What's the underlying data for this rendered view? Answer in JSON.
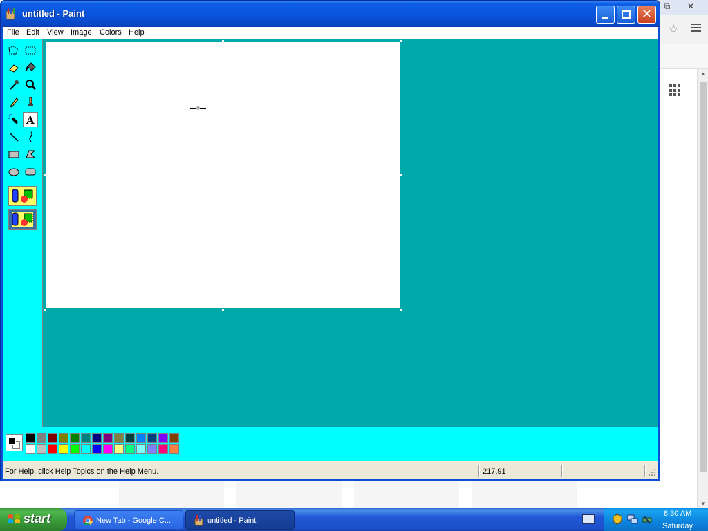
{
  "window": {
    "title": "untitled - Paint",
    "close_symbol": "✕"
  },
  "menubar": [
    "File",
    "Edit",
    "View",
    "Image",
    "Colors",
    "Help"
  ],
  "tools": [
    {
      "name": "free-form-select-icon"
    },
    {
      "name": "select-icon"
    },
    {
      "name": "eraser-icon"
    },
    {
      "name": "fill-with-color-icon"
    },
    {
      "name": "pick-color-icon"
    },
    {
      "name": "magnifier-icon"
    },
    {
      "name": "pencil-icon"
    },
    {
      "name": "brush-icon"
    },
    {
      "name": "airbrush-icon"
    },
    {
      "name": "text-icon",
      "label": "A",
      "selected": true
    },
    {
      "name": "line-icon"
    },
    {
      "name": "curve-icon"
    },
    {
      "name": "rectangle-icon"
    },
    {
      "name": "polygon-icon"
    },
    {
      "name": "ellipse-icon"
    },
    {
      "name": "rounded-rectangle-icon"
    }
  ],
  "tool_options": [
    "opaque-background",
    "transparent-background"
  ],
  "palette": {
    "foreground": "#000000",
    "background": "#ffffff",
    "row1": [
      "#000000",
      "#808080",
      "#800000",
      "#808000",
      "#008000",
      "#008080",
      "#000080",
      "#800080",
      "#808040",
      "#004040",
      "#0080ff",
      "#004080",
      "#8000ff",
      "#804000"
    ],
    "row2": [
      "#ffffff",
      "#c0c0c0",
      "#ff0000",
      "#ffff00",
      "#00ff00",
      "#00ffff",
      "#0000ff",
      "#ff00ff",
      "#ffff80",
      "#00ff80",
      "#80ffff",
      "#8080ff",
      "#ff0080",
      "#ff8040"
    ]
  },
  "colors": {
    "canvas_area": "#00a9a9",
    "toolbox": "#00ffff",
    "titlebar": "#0a55dd"
  },
  "status": {
    "help_text": "For Help, click Help Topics on the Help Menu.",
    "coordinates": "217,91"
  },
  "taskbar": {
    "start_label": "start",
    "tasks": [
      {
        "label": "New Tab - Google C...",
        "icon": "chrome-icon"
      },
      {
        "label": "untitled - Paint",
        "icon": "paint-icon",
        "active": true
      }
    ],
    "clock_time": "8:30 AM",
    "clock_day": "Saturday"
  },
  "background_window": {
    "controls": [
      "⧉",
      "✕"
    ],
    "star_symbol": "☆"
  }
}
